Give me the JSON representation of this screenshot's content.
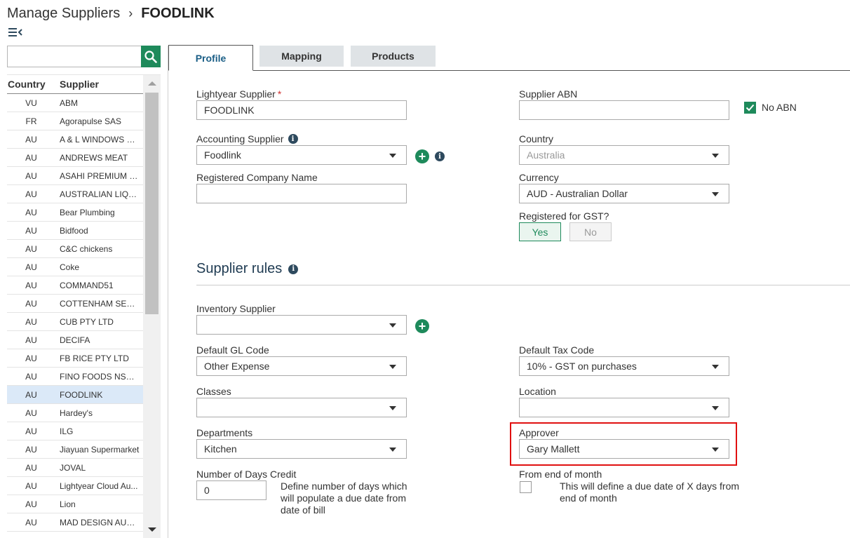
{
  "header": {
    "breadcrumb_root": "Manage Suppliers",
    "breadcrumb_separator": "›",
    "breadcrumb_current": "FOODLINK"
  },
  "search": {
    "value": "",
    "placeholder": ""
  },
  "list": {
    "columns": [
      "Country",
      "Supplier"
    ],
    "rows": [
      {
        "country": "VU",
        "supplier": "ABM"
      },
      {
        "country": "FR",
        "supplier": "Agorapulse SAS"
      },
      {
        "country": "AU",
        "supplier": "A & L WINDOWS PT..."
      },
      {
        "country": "AU",
        "supplier": "ANDREWS MEAT"
      },
      {
        "country": "AU",
        "supplier": "ASAHI PREMIUM B..."
      },
      {
        "country": "AU",
        "supplier": "AUSTRALIAN LIQU..."
      },
      {
        "country": "AU",
        "supplier": "Bear Plumbing"
      },
      {
        "country": "AU",
        "supplier": "Bidfood"
      },
      {
        "country": "AU",
        "supplier": "C&C chickens"
      },
      {
        "country": "AU",
        "supplier": "Coke"
      },
      {
        "country": "AU",
        "supplier": "COMMAND51"
      },
      {
        "country": "AU",
        "supplier": "COTTENHAM SERV..."
      },
      {
        "country": "AU",
        "supplier": "CUB PTY LTD"
      },
      {
        "country": "AU",
        "supplier": "DECIFA"
      },
      {
        "country": "AU",
        "supplier": "FB RICE PTY LTD"
      },
      {
        "country": "AU",
        "supplier": "FINO FOODS NSW ..."
      },
      {
        "country": "AU",
        "supplier": "FOODLINK"
      },
      {
        "country": "AU",
        "supplier": "Hardey's"
      },
      {
        "country": "AU",
        "supplier": "ILG"
      },
      {
        "country": "AU",
        "supplier": "Jiayuan Supermarket"
      },
      {
        "country": "AU",
        "supplier": "JOVAL"
      },
      {
        "country": "AU",
        "supplier": "Lightyear Cloud Au..."
      },
      {
        "country": "AU",
        "supplier": "Lion"
      },
      {
        "country": "AU",
        "supplier": "MAD DESIGN AUST..."
      }
    ],
    "selected_index": 16
  },
  "tabs": [
    {
      "label": "Profile",
      "active": true
    },
    {
      "label": "Mapping",
      "active": false
    },
    {
      "label": "Products",
      "active": false
    }
  ],
  "profile": {
    "lightyear_supplier": {
      "label": "Lightyear Supplier",
      "required_mark": "*",
      "value": "FOODLINK"
    },
    "supplier_abn": {
      "label": "Supplier ABN",
      "value": ""
    },
    "no_abn": {
      "label": "No ABN",
      "checked": true
    },
    "accounting_supplier": {
      "label": "Accounting Supplier",
      "value": "Foodlink"
    },
    "country": {
      "label": "Country",
      "value": "Australia"
    },
    "registered_company_name": {
      "label": "Registered Company Name",
      "value": ""
    },
    "currency": {
      "label": "Currency",
      "value": "AUD - Australian Dollar"
    },
    "registered_gst": {
      "label": "Registered for GST?",
      "yes": "Yes",
      "no": "No",
      "selected": "Yes"
    }
  },
  "rules": {
    "title": "Supplier rules",
    "inventory_supplier": {
      "label": "Inventory Supplier",
      "value": ""
    },
    "default_gl_code": {
      "label": "Default GL Code",
      "value": "Other Expense"
    },
    "default_tax_code": {
      "label": "Default Tax Code",
      "value": "10% - GST on purchases"
    },
    "classes": {
      "label": "Classes",
      "value": ""
    },
    "location": {
      "label": "Location",
      "value": ""
    },
    "departments": {
      "label": "Departments",
      "value": "Kitchen"
    },
    "approver": {
      "label": "Approver",
      "value": "Gary Mallett"
    },
    "days_credit": {
      "label": "Number of Days Credit",
      "value": "0",
      "help": "Define number of days which will populate a due date from date of bill"
    },
    "end_of_month": {
      "label": "From end of month",
      "checked": false,
      "help": "This will define a due date of X days from end of month"
    }
  },
  "colors": {
    "accent": "#1e8a5b",
    "tab_active_text": "#1a5e86",
    "highlight": "#e01010",
    "selected_row": "#dbe9f8"
  }
}
